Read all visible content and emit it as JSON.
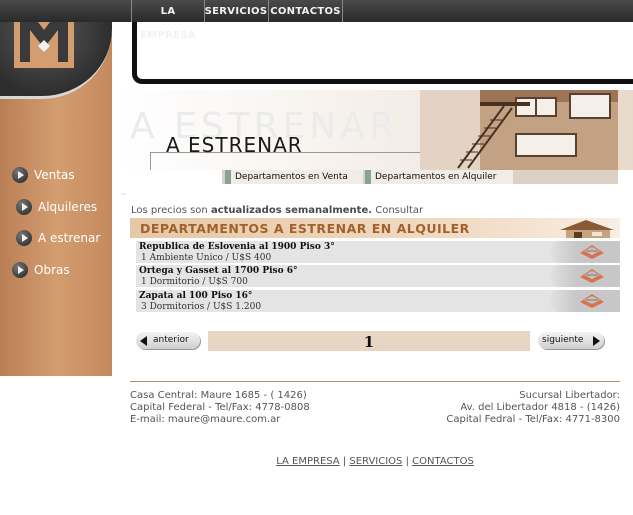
{
  "top_nav": [
    "LA EMPRESA",
    "SERVICIOS",
    "CONTACTOS"
  ],
  "sidebar": {
    "items": [
      {
        "label": "Ventas"
      },
      {
        "label": "Alquileres"
      },
      {
        "label": "A estrenar"
      },
      {
        "label": "Obras"
      }
    ]
  },
  "banner": {
    "ghost_text": "A ESTRENAR",
    "title": "A ESTRENAR"
  },
  "subtabs": [
    "Departamentos en Venta",
    "Departamentos en Alquiler"
  ],
  "info": {
    "prefix": "Los precios son",
    "highlight": "actualizados semanalmente.",
    "suffix": "Consultar"
  },
  "listing": {
    "title": "DEPARTAMENTOS A ESTRENAR EN ALQUILER",
    "rows": [
      {
        "address": "Republica de Eslovenia al 1900 Piso 3°",
        "detail": "1 Ambiente Unico / U$S 400"
      },
      {
        "address": "Ortega y Gasset al 1700 Piso 6°",
        "detail": "1 Dormitorio / U$S 700"
      },
      {
        "address": "Zapata al 100 Piso 16°",
        "detail": "3 Dormitorios / U$S 1.200"
      }
    ]
  },
  "pager": {
    "prev_label": "anterior",
    "next_label": "siguiente",
    "current_page": "1"
  },
  "footer": {
    "left": [
      "Casa Central: Maure 1685 - ( 1426)",
      "Capital Federal - Tel/Fax: 4778-0808",
      "E-mail: maure@maure.com.ar"
    ],
    "right": [
      "Sucursal Libertador:",
      "Av. del Libertador 4818 - (1426)",
      "Capital Fedral - Tel/Fax: 4771-8300"
    ],
    "links": [
      "LA EMPRESA",
      "SERVICIOS",
      "CONTACTOS"
    ],
    "separator": "|"
  },
  "colors": {
    "sidebar": "#c48a5d",
    "accent_text": "#a0612d",
    "topbar": "#333333"
  }
}
